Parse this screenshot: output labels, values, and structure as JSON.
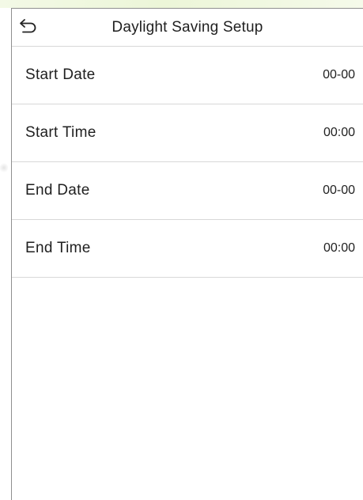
{
  "header": {
    "title": "Daylight Saving Setup",
    "back_icon": "back-arrow-icon"
  },
  "settings": [
    {
      "label": "Start Date",
      "value": "00-00"
    },
    {
      "label": "Start Time",
      "value": "00:00"
    },
    {
      "label": "End Date",
      "value": "00-00"
    },
    {
      "label": "End Time",
      "value": "00:00"
    }
  ],
  "colors": {
    "text": "#1f1f1f",
    "divider": "#d8d8d8",
    "frame": "#8f8f8f",
    "background": "#ffffff",
    "accent_tint": "#ecf6d8"
  }
}
